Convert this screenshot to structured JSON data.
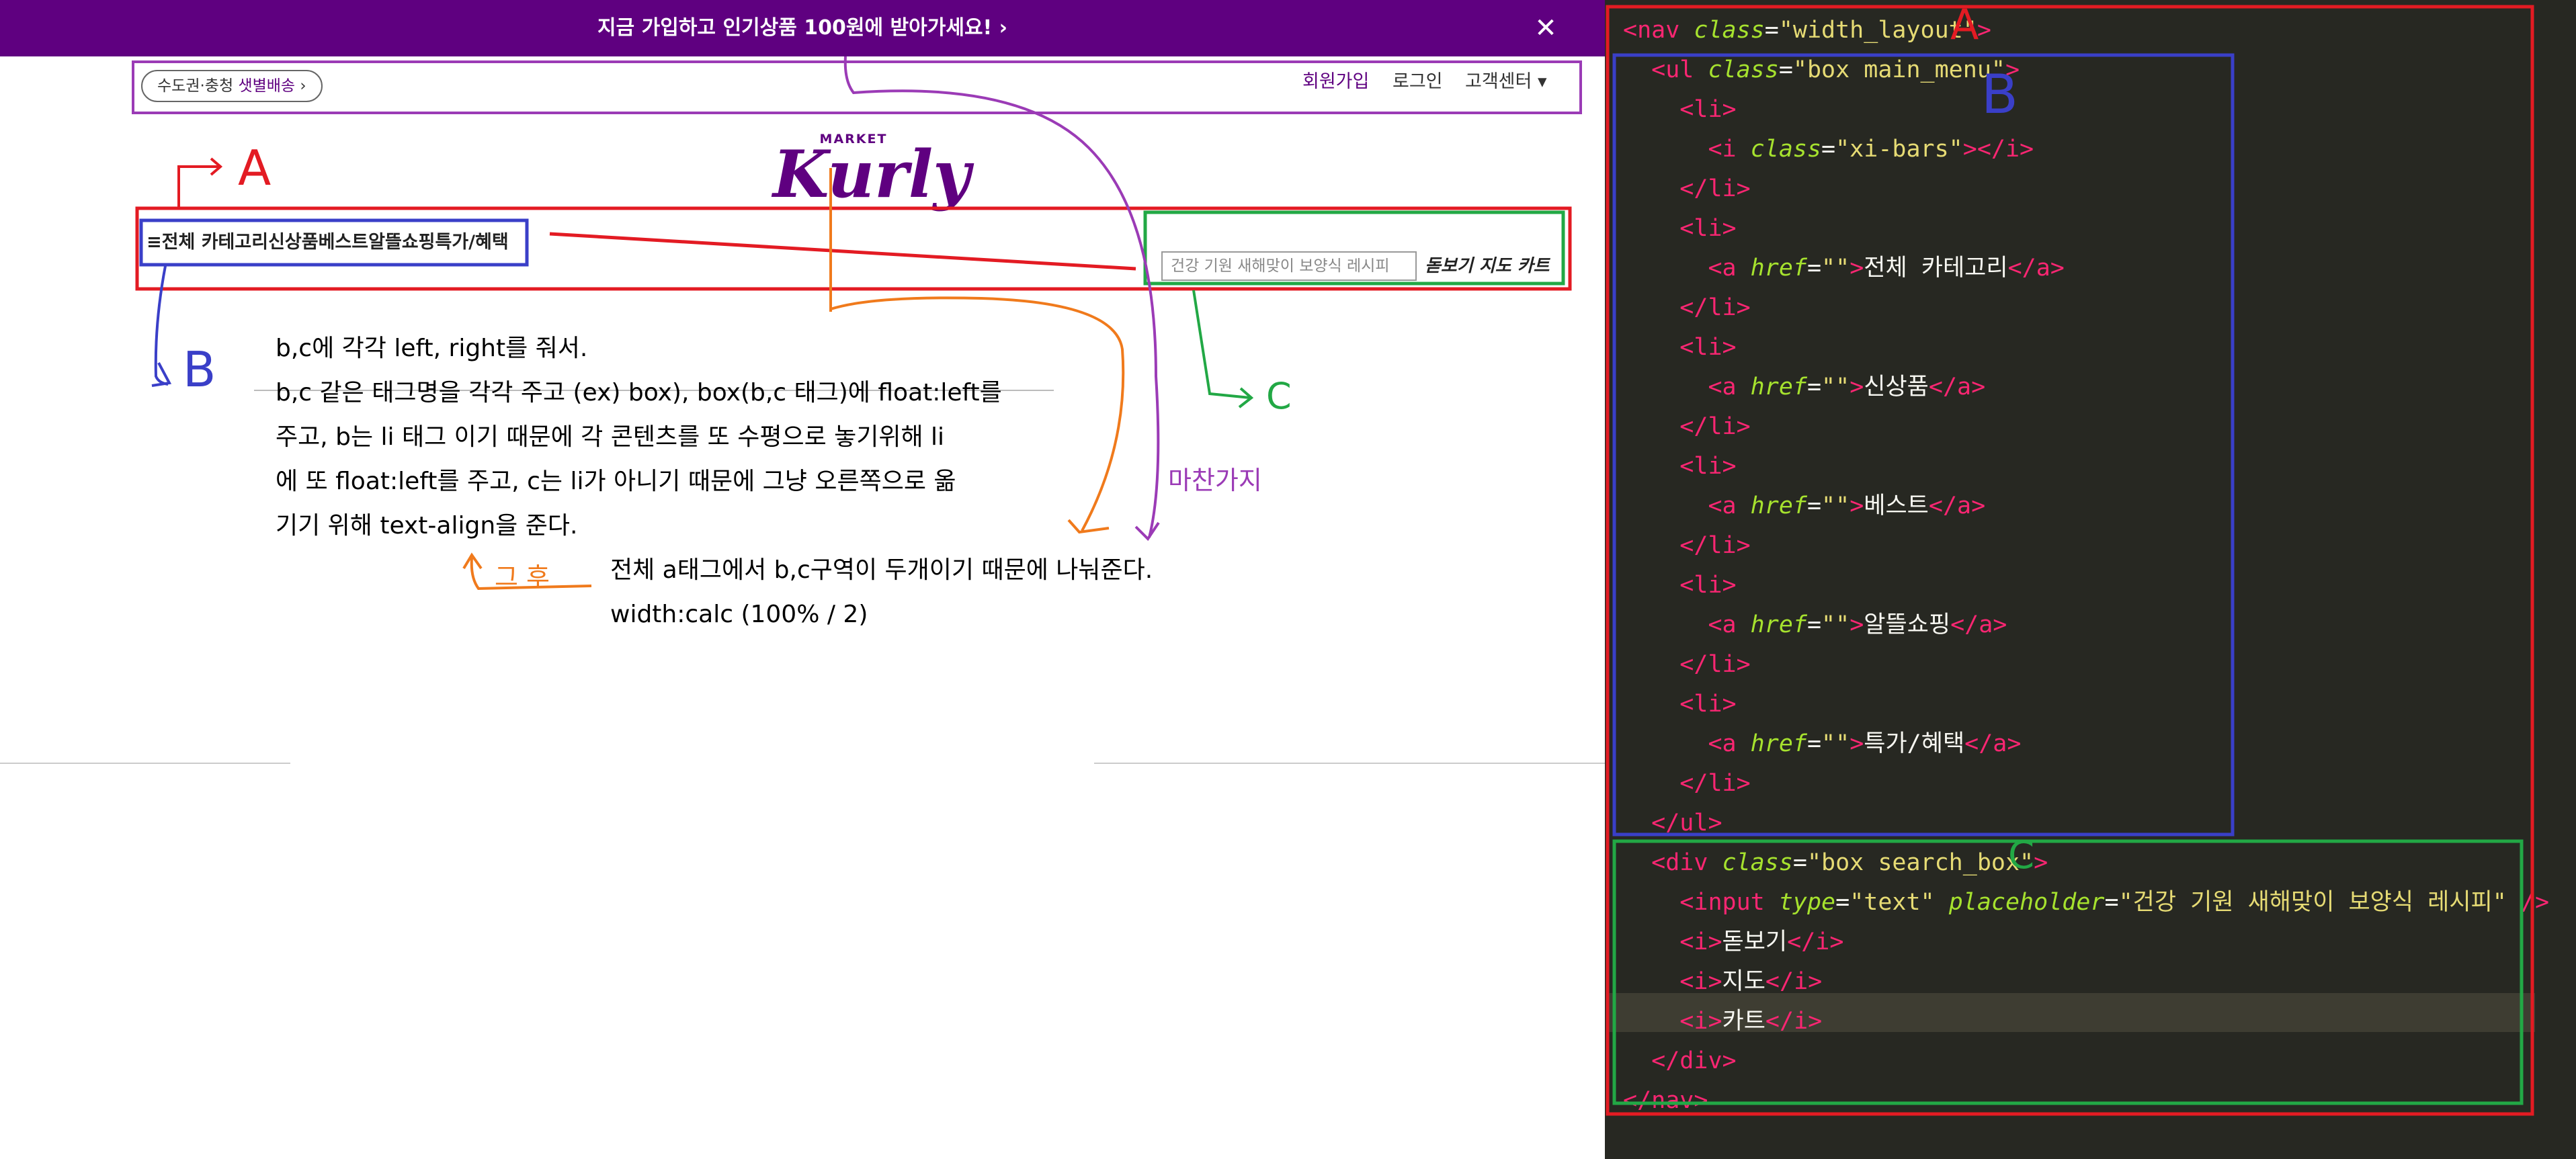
{
  "banner": {
    "text": "지금 가입하고 인기상품 100원에 받아가세요!  ›",
    "close": "✕"
  },
  "header": {
    "delivery_pill_prefix": "수도권·충청 ",
    "delivery_pill_highlight": "샛별배송",
    "delivery_pill_suffix": " ›",
    "links": [
      "회원가입",
      "로그인",
      "고객센터 ▾"
    ]
  },
  "logo": {
    "small": "MARKET",
    "main": "Kurly"
  },
  "nav": {
    "menu_text": "≡전체 카테고리신상품베스트알뜰쇼핑특가/혜택",
    "search_placeholder": "건강 기원 새해맞이 보양식 레시피",
    "icons_text": "돋보기 지도 카트"
  },
  "annotations": {
    "label_a": "A",
    "label_b": "B",
    "label_c": "C",
    "label_same": "마찬가지",
    "label_after": "그 후",
    "note_lines": [
      "b,c에 각각 left, right를 줘서.",
      "b,c 같은 태그명을 각각 주고 (ex) box),  box(b,c 태그)에 float:left를",
      "주고, b는 li 태그 이기 때문에 각 콘텐츠를 또 수평으로 놓기위해 li",
      "에 또 float:left를 주고, c는 li가 아니기 때문에 그냥 오른쪽으로 옮",
      "기기 위해 text-align을 준다."
    ],
    "after_lines": [
      "전체 a태그에서 b,c구역이 두개이기 때문에 나눠준다.",
      "width:calc (100% / 2)"
    ]
  },
  "editor": {
    "labels": {
      "a": "A",
      "b": "B",
      "c": "C"
    },
    "lines": [
      {
        "indent": "",
        "tokens": [
          [
            "t",
            "<nav"
          ],
          [
            "p",
            " "
          ],
          [
            "an",
            "class"
          ],
          [
            "p",
            "="
          ],
          [
            "s",
            "\"width_layout\""
          ],
          [
            "t",
            ">"
          ]
        ]
      },
      {
        "indent": "  ",
        "tokens": [
          [
            "t",
            "<ul"
          ],
          [
            "p",
            " "
          ],
          [
            "an",
            "class"
          ],
          [
            "p",
            "="
          ],
          [
            "s",
            "\"box main_menu\""
          ],
          [
            "t",
            ">"
          ]
        ]
      },
      {
        "indent": "    ",
        "tokens": [
          [
            "t",
            "<li>"
          ]
        ]
      },
      {
        "indent": "      ",
        "tokens": [
          [
            "t",
            "<i"
          ],
          [
            "p",
            " "
          ],
          [
            "an",
            "class"
          ],
          [
            "p",
            "="
          ],
          [
            "s",
            "\"xi-bars\""
          ],
          [
            "t",
            "></i>"
          ]
        ]
      },
      {
        "indent": "    ",
        "tokens": [
          [
            "t",
            "</li>"
          ]
        ]
      },
      {
        "indent": "    ",
        "tokens": [
          [
            "t",
            "<li>"
          ]
        ]
      },
      {
        "indent": "      ",
        "tokens": [
          [
            "t",
            "<a"
          ],
          [
            "p",
            " "
          ],
          [
            "an",
            "href"
          ],
          [
            "p",
            "="
          ],
          [
            "s",
            "\"\""
          ],
          [
            "t",
            ">"
          ],
          [
            "tx",
            "전체 카테고리"
          ],
          [
            "t",
            "</a>"
          ]
        ]
      },
      {
        "indent": "    ",
        "tokens": [
          [
            "t",
            "</li>"
          ]
        ]
      },
      {
        "indent": "    ",
        "tokens": [
          [
            "t",
            "<li>"
          ]
        ]
      },
      {
        "indent": "      ",
        "tokens": [
          [
            "t",
            "<a"
          ],
          [
            "p",
            " "
          ],
          [
            "an",
            "href"
          ],
          [
            "p",
            "="
          ],
          [
            "s",
            "\"\""
          ],
          [
            "t",
            ">"
          ],
          [
            "tx",
            "신상품"
          ],
          [
            "t",
            "</a>"
          ]
        ]
      },
      {
        "indent": "    ",
        "tokens": [
          [
            "t",
            "</li>"
          ]
        ]
      },
      {
        "indent": "    ",
        "tokens": [
          [
            "t",
            "<li>"
          ]
        ]
      },
      {
        "indent": "      ",
        "tokens": [
          [
            "t",
            "<a"
          ],
          [
            "p",
            " "
          ],
          [
            "an",
            "href"
          ],
          [
            "p",
            "="
          ],
          [
            "s",
            "\"\""
          ],
          [
            "t",
            ">"
          ],
          [
            "tx",
            "베스트"
          ],
          [
            "t",
            "</a>"
          ]
        ]
      },
      {
        "indent": "    ",
        "tokens": [
          [
            "t",
            "</li>"
          ]
        ]
      },
      {
        "indent": "    ",
        "tokens": [
          [
            "t",
            "<li>"
          ]
        ]
      },
      {
        "indent": "      ",
        "tokens": [
          [
            "t",
            "<a"
          ],
          [
            "p",
            " "
          ],
          [
            "an",
            "href"
          ],
          [
            "p",
            "="
          ],
          [
            "s",
            "\"\""
          ],
          [
            "t",
            ">"
          ],
          [
            "tx",
            "알뜰쇼핑"
          ],
          [
            "t",
            "</a>"
          ]
        ]
      },
      {
        "indent": "    ",
        "tokens": [
          [
            "t",
            "</li>"
          ]
        ]
      },
      {
        "indent": "    ",
        "tokens": [
          [
            "t",
            "<li>"
          ]
        ]
      },
      {
        "indent": "      ",
        "tokens": [
          [
            "t",
            "<a"
          ],
          [
            "p",
            " "
          ],
          [
            "an",
            "href"
          ],
          [
            "p",
            "="
          ],
          [
            "s",
            "\"\""
          ],
          [
            "t",
            ">"
          ],
          [
            "tx",
            "특가/혜택"
          ],
          [
            "t",
            "</a>"
          ]
        ]
      },
      {
        "indent": "    ",
        "tokens": [
          [
            "t",
            "</li>"
          ]
        ]
      },
      {
        "indent": "  ",
        "tokens": [
          [
            "t",
            "</ul>"
          ]
        ]
      },
      {
        "indent": "  ",
        "tokens": [
          [
            "t",
            "<div"
          ],
          [
            "p",
            " "
          ],
          [
            "an",
            "class"
          ],
          [
            "p",
            "="
          ],
          [
            "s",
            "\"box search_box\""
          ],
          [
            "t",
            ">"
          ]
        ]
      },
      {
        "indent": "    ",
        "tokens": [
          [
            "t",
            "<input"
          ],
          [
            "p",
            " "
          ],
          [
            "an",
            "type"
          ],
          [
            "p",
            "="
          ],
          [
            "s",
            "\"text\""
          ],
          [
            "p",
            " "
          ],
          [
            "an",
            "placeholder"
          ],
          [
            "p",
            "="
          ],
          [
            "s",
            "\"건강 기원 새해맞이 보양식 레시피\""
          ],
          [
            "p",
            " "
          ],
          [
            "t",
            "/>"
          ]
        ]
      },
      {
        "indent": "    ",
        "tokens": [
          [
            "t",
            "<i>"
          ],
          [
            "tx",
            "돋보기"
          ],
          [
            "t",
            "</i>"
          ]
        ]
      },
      {
        "indent": "    ",
        "tokens": [
          [
            "t",
            "<i>"
          ],
          [
            "tx",
            "지도"
          ],
          [
            "t",
            "</i>"
          ]
        ]
      },
      {
        "indent": "    ",
        "tokens": [
          [
            "t",
            "<i>"
          ],
          [
            "tx",
            "카트"
          ],
          [
            "t",
            "</i>"
          ]
        ]
      },
      {
        "indent": "  ",
        "tokens": [
          [
            "t",
            "</div>"
          ]
        ]
      },
      {
        "indent": "",
        "tokens": [
          [
            "t",
            "</nav>"
          ]
        ]
      }
    ]
  },
  "colors": {
    "brand": "#5f0080",
    "box_a": "#e31b23",
    "box_b": "#3a3fc8",
    "box_c": "#22a845",
    "orange": "#f07a1c",
    "editor_bg": "#272822"
  }
}
